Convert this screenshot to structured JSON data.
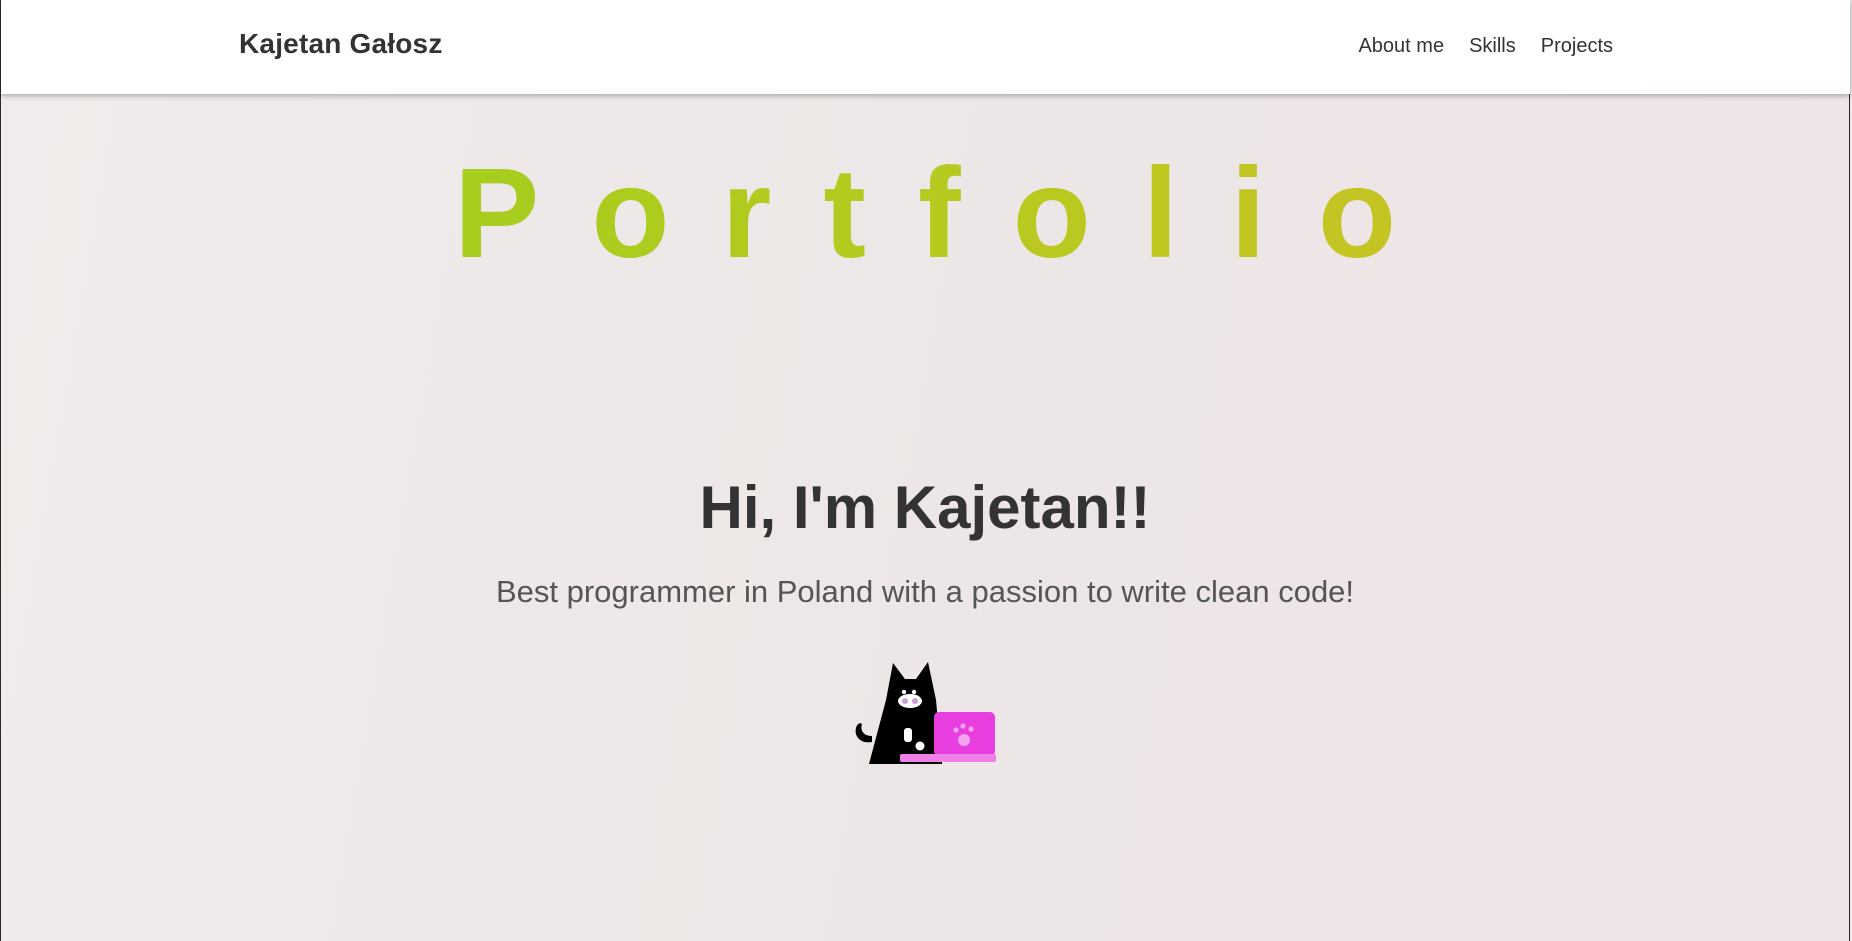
{
  "navbar": {
    "brand": "Kajetan Gałosz",
    "links": [
      {
        "label": "About me"
      },
      {
        "label": "Skills"
      },
      {
        "label": "Projects"
      }
    ]
  },
  "hero": {
    "banner": "Portfolio",
    "title": "Hi, I'm Kajetan!!",
    "subtitle": "Best programmer in Poland with a passion to write clean code!"
  },
  "illustration": {
    "icon": "cat-with-laptop-icon",
    "colors": {
      "cat": "#000000",
      "laptop": "#e83ee0",
      "laptop_base": "#f07fe8",
      "paw": "#f6a3ef"
    }
  },
  "theme": {
    "banner_gradient": [
      "#97d11d",
      "#d2bf2a"
    ],
    "text": "#333333",
    "subtitle_text": "#555555"
  }
}
